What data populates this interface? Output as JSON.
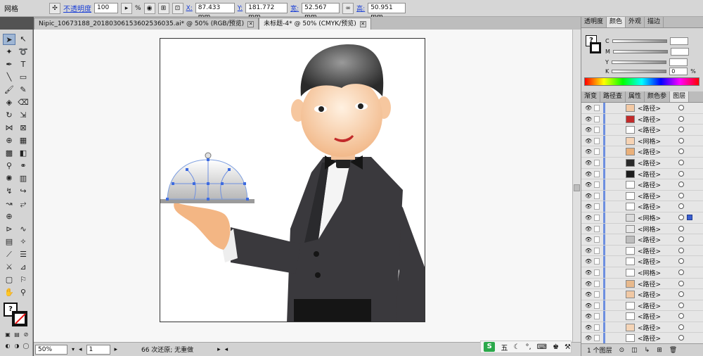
{
  "control": {
    "mode": "网格",
    "opacity_label": "不透明度",
    "opacity_value": "100",
    "percent": "%",
    "x_label": "X:",
    "x_value": "87.433 mm",
    "y_label": "Y:",
    "y_value": "181.772 mm",
    "w_label": "宽:",
    "w_value": "52.567 mm",
    "h_label": "高:",
    "h_value": "50.951 mm"
  },
  "tabs": [
    {
      "label": "Nipic_10673188_20180306153602536035.ai* @ 50% (RGB/预览)"
    },
    {
      "label": "未标题-4* @ 50% (CMYK/预览)"
    }
  ],
  "status": {
    "zoom": "50%",
    "page": "1",
    "undo": "66 次还原; 无重做"
  },
  "color_panel": {
    "tabs": [
      "透明度",
      "颜色",
      "外观",
      "描边"
    ],
    "channels": [
      {
        "label": "C",
        "value": ""
      },
      {
        "label": "M",
        "value": ""
      },
      {
        "label": "Y",
        "value": ""
      },
      {
        "label": "K",
        "value": "0"
      }
    ],
    "k_unit": "%"
  },
  "layers_panel": {
    "tabs": [
      "渐变",
      "路径查",
      "属性",
      "颜色参",
      "图层"
    ],
    "rows": [
      {
        "name": "<路径>",
        "thumb": "#f3c9a4"
      },
      {
        "name": "<路径>",
        "thumb": "#c22a2a"
      },
      {
        "name": "<路径>",
        "thumb": "#ffffff"
      },
      {
        "name": "<网格>",
        "thumb": "#f6d3b4"
      },
      {
        "name": "<路径>",
        "thumb": "#eab07a"
      },
      {
        "name": "<路径>",
        "thumb": "#2a2a2a"
      },
      {
        "name": "<路径>",
        "thumb": "#1b1b1b"
      },
      {
        "name": "<路径>",
        "thumb": "#ffffff"
      },
      {
        "name": "<路径>",
        "thumb": "#ffffff"
      },
      {
        "name": "<路径>",
        "thumb": "#ffffff"
      },
      {
        "name": "<网格>",
        "thumb": "#dcdcdc",
        "selected": true
      },
      {
        "name": "<网格>",
        "thumb": "#e9e9e9"
      },
      {
        "name": "<路径>",
        "thumb": "#bdbdbd"
      },
      {
        "name": "<路径>",
        "thumb": "#ffffff"
      },
      {
        "name": "<路径>",
        "thumb": "#ffffff"
      },
      {
        "name": "<网格>",
        "thumb": "#ffffff"
      },
      {
        "name": "<路径>",
        "thumb": "#e8b98c"
      },
      {
        "name": "<路径>",
        "thumb": "#f0c8a4"
      },
      {
        "name": "<路径>",
        "thumb": "#ffffff"
      },
      {
        "name": "<路径>",
        "thumb": "#ffffff"
      },
      {
        "name": "<路径>",
        "thumb": "#f4d4b6"
      },
      {
        "name": "<路径>",
        "thumb": "#ffffff"
      }
    ],
    "footer": "1 个图层"
  },
  "ime": {
    "label": "五"
  },
  "colors": {
    "suit": "#3a393d",
    "skin": "#f7c79d",
    "hair": "#3c3c3c",
    "dome": "#d9d9d9",
    "accent": "#1a3fd6"
  }
}
